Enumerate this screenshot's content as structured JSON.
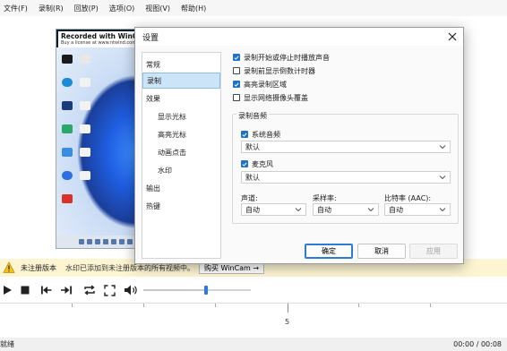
{
  "menubar": {
    "items": [
      "文件(F)",
      "录制(R)",
      "回放(P)",
      "选项(O)",
      "视图(V)",
      "帮助(H)"
    ]
  },
  "preview": {
    "watermark_title": "Recorded with WinCam",
    "watermark_sub": "Buy a license at www.ntwind.com"
  },
  "banner": {
    "badge": "未注册版本",
    "message": "水印已添加到未注册版本的所有视频中。",
    "buy_label": "购买 WinCam →",
    "color": "#fdf5d2"
  },
  "controls": {
    "volume_level": 0.58
  },
  "timeline": {
    "tick_label": "5"
  },
  "status": {
    "left": "就绪",
    "right": "00:00 / 00:08"
  },
  "dialog": {
    "title": "设置",
    "nav": [
      {
        "label": "常规",
        "sub": false,
        "active": false
      },
      {
        "label": "录制",
        "sub": false,
        "active": true
      },
      {
        "label": "效果",
        "sub": false,
        "active": false
      },
      {
        "label": "显示光标",
        "sub": true,
        "active": false
      },
      {
        "label": "高亮光标",
        "sub": true,
        "active": false
      },
      {
        "label": "动画点击",
        "sub": true,
        "active": false
      },
      {
        "label": "水印",
        "sub": true,
        "active": false
      },
      {
        "label": "输出",
        "sub": false,
        "active": false
      },
      {
        "label": "热键",
        "sub": false,
        "active": false
      }
    ],
    "options": [
      {
        "label": "录制开始或停止时播放声音",
        "checked": true
      },
      {
        "label": "录制前显示倒数计时器",
        "checked": false
      },
      {
        "label": "高亮录制区域",
        "checked": true
      },
      {
        "label": "显示网络摄像头覆盖",
        "checked": false
      }
    ],
    "audio": {
      "group_title": "录制音频",
      "system_label": "系统音频",
      "system_checked": true,
      "system_device": "默认",
      "mic_label": "麦克风",
      "mic_checked": true,
      "mic_device": "默认",
      "channels_label": "声道:",
      "channels_value": "自动",
      "samplerate_label": "采样率:",
      "samplerate_value": "自动",
      "bitrate_label": "比特率 (AAC):",
      "bitrate_value": "自动"
    },
    "buttons": {
      "ok": "确定",
      "cancel": "取消",
      "apply": "应用"
    }
  },
  "colors": {
    "accent": "#1e73c8",
    "nav_active": "#cce4f7"
  }
}
